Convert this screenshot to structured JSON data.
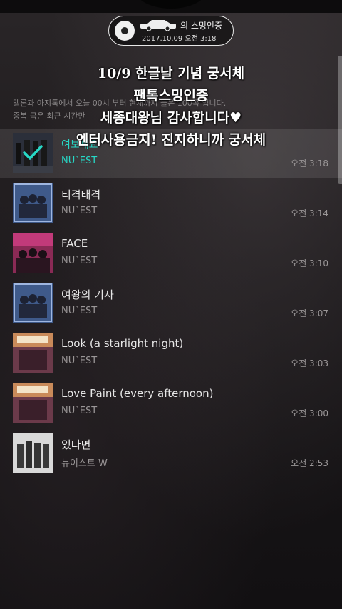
{
  "badge": {
    "title": "의 스밍인증",
    "date": "2017.10.09 오전 3:18"
  },
  "caption": {
    "lines": [
      "10/9 한글날 기념 궁서체",
      "팬톡스밍인증",
      "세종대왕님 감사합니다♥",
      "엔터사용금지! 진지하니까 궁서체"
    ]
  },
  "notice": {
    "line1": "멜론과 아지톡에서 오늘 00시 부터 현재까지 들은 100곡 입니다.",
    "line2": "중복 곡은 최근 시간만"
  },
  "songs": [
    {
      "title": "여보세요",
      "artist": "NU`EST",
      "time": "오전 3:18",
      "current": true
    },
    {
      "title": "티격태격",
      "artist": "NU`EST",
      "time": "오전 3:14"
    },
    {
      "title": "FACE",
      "artist": "NU`EST",
      "time": "오전 3:10"
    },
    {
      "title": "여왕의 기사",
      "artist": "NU`EST",
      "time": "오전 3:07"
    },
    {
      "title": "Look (a starlight night)",
      "artist": "NU`EST",
      "time": "오전 3:03"
    },
    {
      "title": "Love Paint (every afternoon)",
      "artist": "NU`EST",
      "time": "오전 3:00"
    },
    {
      "title": "있다면",
      "artist": "뉴이스트 W",
      "time": "오전 2:53"
    }
  ],
  "colors": {
    "accent": "#27d8c6",
    "background": "#141214"
  }
}
